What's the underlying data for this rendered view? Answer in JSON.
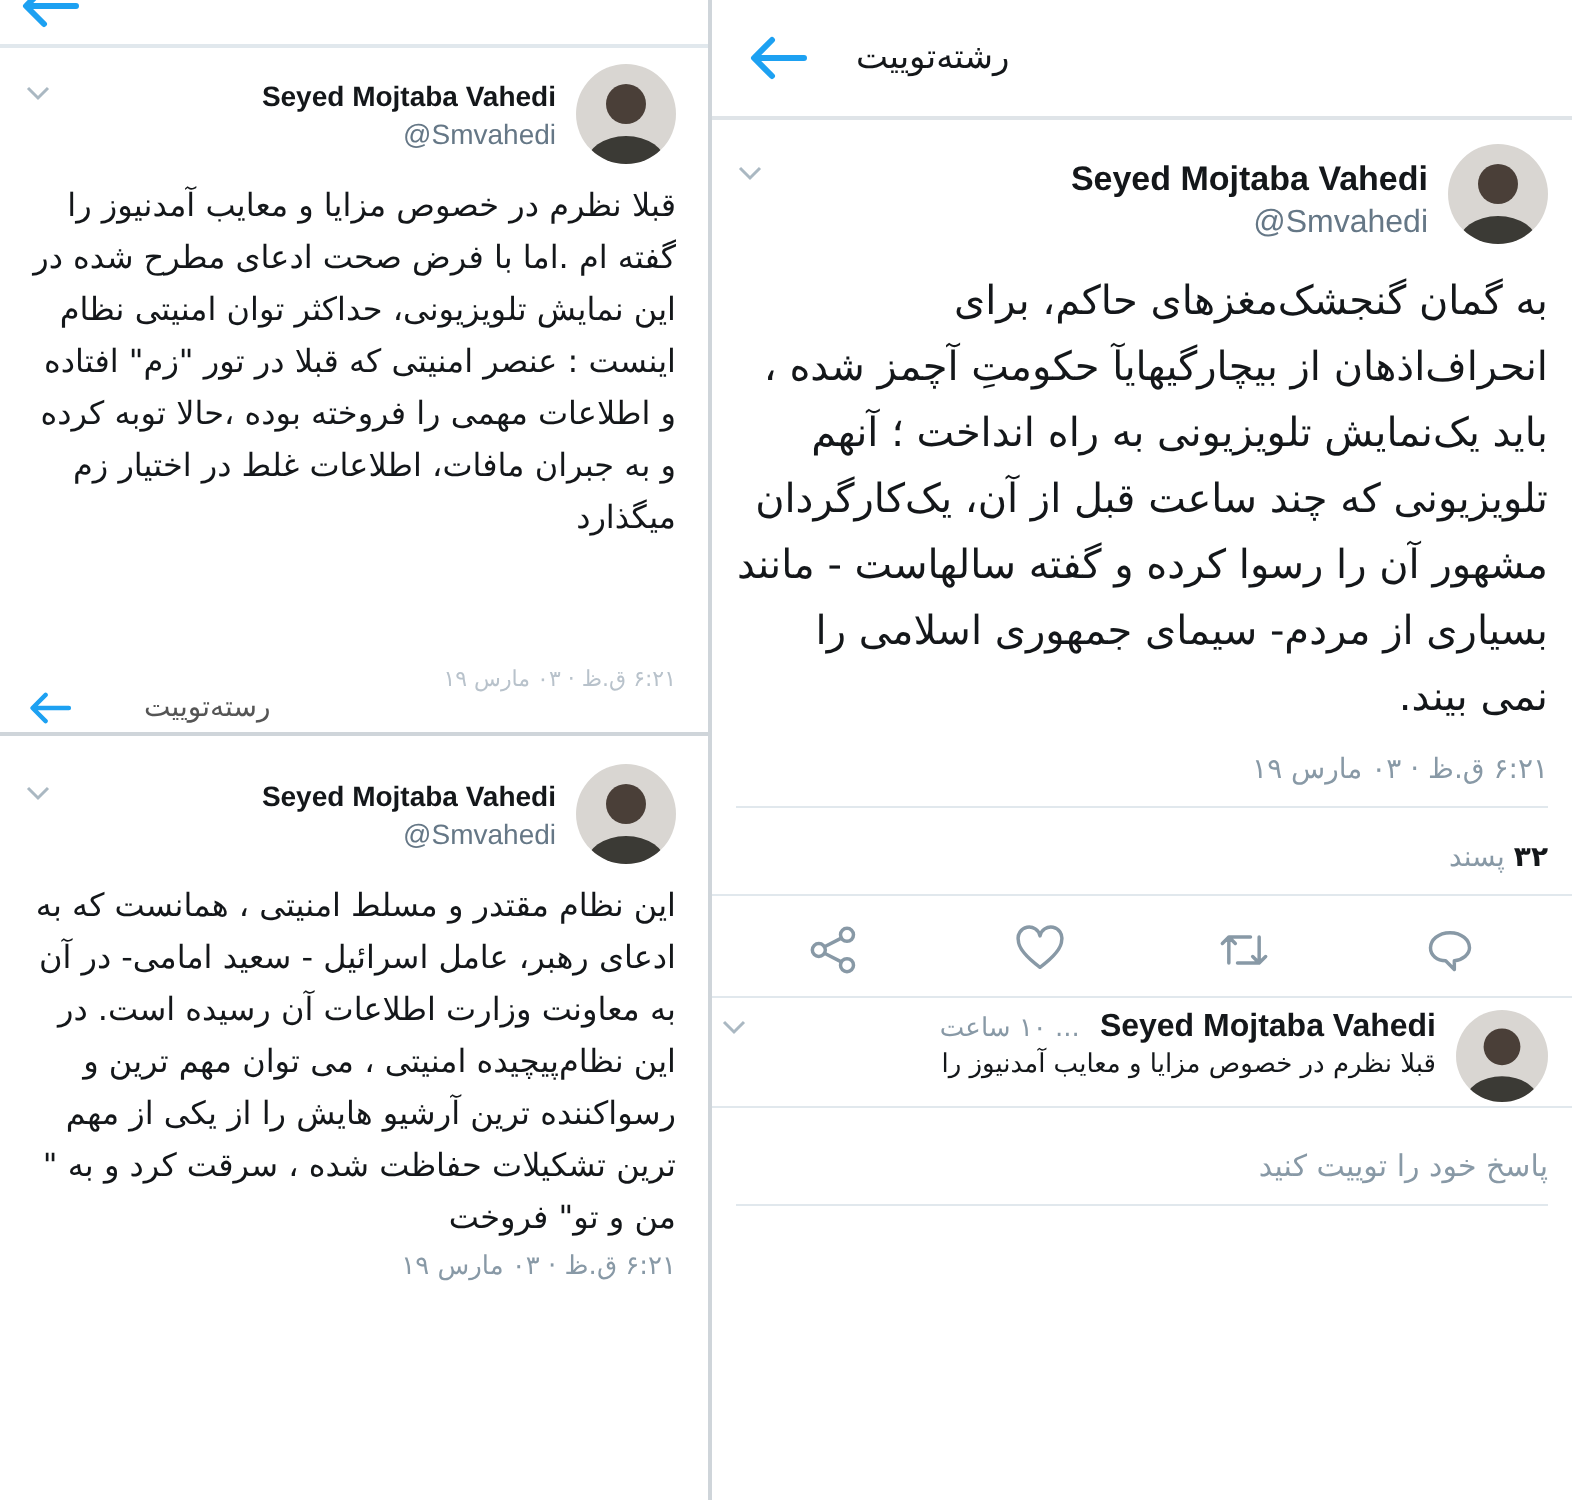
{
  "left_top": {
    "author": {
      "name": "Seyed Mojtaba Vahedi",
      "handle": "@Smvahedi"
    },
    "text": "قبلا نظرم در خصوص مزایا و معایب آمدنیوز را گفته ام .اما با فرض صحت ادعای مطرح شده در این نمایش تلویزیونی، حداکثر توان امنیتی  نظام اینست : عنصر امنیتی که قبلا در تور \"زم\" افتاده و اطلاعات مهمی را فروخته بوده ،حالا توبه کرده و به جبران مافات، اطلاعات غلط در اختیار زم میگذارد",
    "timestamp": "۶:۲۱ ق.ظ · ۰۳ مارس ۱۹",
    "next_header": {
      "title": "رسته‌توییت"
    }
  },
  "left_bottom": {
    "author": {
      "name": "Seyed Mojtaba Vahedi",
      "handle": "@Smvahedi"
    },
    "text": "این نظام مقتدر و مسلط امنیتی ، همانست که به ادعای رهبر، عامل اسرائیل - سعید امامی- در آن به معاونت وزارت اطلاعات آن رسیده است. در این نظام‌پیچیده امنیتی ، می توان  مهم ترین و رسواکننده ترین آرشیو هایش را از یکی از مهم ترین تشکیلات حفاظت شده ، سرقت کرد و به \" من و تو\" فروخت",
    "timestamp": "۶:۲۱ ق.ظ · ۰۳ مارس ۱۹"
  },
  "main": {
    "header": {
      "title": "رشته‌توییت"
    },
    "author": {
      "name": "Seyed Mojtaba Vahedi",
      "handle": "@Smvahedi"
    },
    "text": "به گمان گنجشک‌مغزهای حاکم، برای انحراف‌اذهان از بیچارگیهایآ حکومتِ آچمز شده ، باید  یک‌نمایش تلویزیونی به راه انداخت ؛ آنهم تلویزیونی که چند ساعت قبل از آن، یک‌کارگردان مشهور آن را رسوا کرده و گفته سالهاست - مانند بسیاری از مردم- سیمای جمهوری اسلامی را نمی بیند.",
    "timestamp": "۶:۲۱ ق.ظ · ۰۳ مارس ۱۹",
    "likes": "**۳۲** پسند",
    "actions": [
      {
        "kind": "share"
      },
      {
        "kind": "like"
      },
      {
        "kind": "retweet"
      },
      {
        "kind": "reply"
      }
    ],
    "reply_preview": {
      "name": "Seyed Mojtaba Vahedi",
      "time": "... ۱۰ ساعت",
      "text": "قبلا نظرم در خصوص مزایا و معایب آمدنیوز را"
    },
    "reply_field": {
      "placeholder": "پاسخ خود را توییت کنید"
    }
  }
}
